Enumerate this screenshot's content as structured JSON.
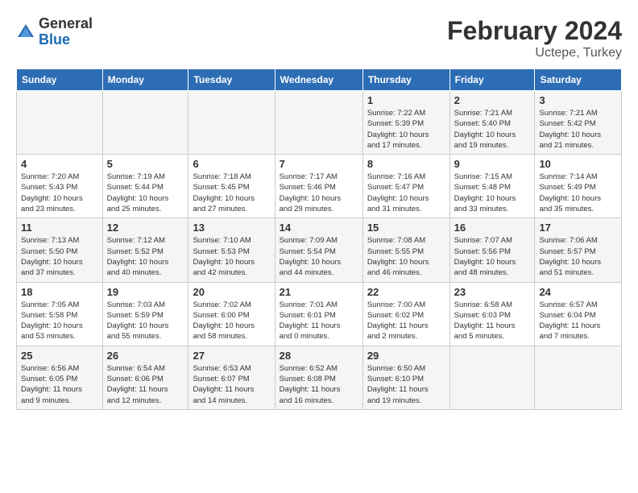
{
  "header": {
    "logo_general": "General",
    "logo_blue": "Blue",
    "month_title": "February 2024",
    "location": "Uctepe, Turkey"
  },
  "calendar": {
    "weekdays": [
      "Sunday",
      "Monday",
      "Tuesday",
      "Wednesday",
      "Thursday",
      "Friday",
      "Saturday"
    ],
    "weeks": [
      [
        {
          "day": "",
          "info": ""
        },
        {
          "day": "",
          "info": ""
        },
        {
          "day": "",
          "info": ""
        },
        {
          "day": "",
          "info": ""
        },
        {
          "day": "1",
          "info": "Sunrise: 7:22 AM\nSunset: 5:39 PM\nDaylight: 10 hours\nand 17 minutes."
        },
        {
          "day": "2",
          "info": "Sunrise: 7:21 AM\nSunset: 5:40 PM\nDaylight: 10 hours\nand 19 minutes."
        },
        {
          "day": "3",
          "info": "Sunrise: 7:21 AM\nSunset: 5:42 PM\nDaylight: 10 hours\nand 21 minutes."
        }
      ],
      [
        {
          "day": "4",
          "info": "Sunrise: 7:20 AM\nSunset: 5:43 PM\nDaylight: 10 hours\nand 23 minutes."
        },
        {
          "day": "5",
          "info": "Sunrise: 7:19 AM\nSunset: 5:44 PM\nDaylight: 10 hours\nand 25 minutes."
        },
        {
          "day": "6",
          "info": "Sunrise: 7:18 AM\nSunset: 5:45 PM\nDaylight: 10 hours\nand 27 minutes."
        },
        {
          "day": "7",
          "info": "Sunrise: 7:17 AM\nSunset: 5:46 PM\nDaylight: 10 hours\nand 29 minutes."
        },
        {
          "day": "8",
          "info": "Sunrise: 7:16 AM\nSunset: 5:47 PM\nDaylight: 10 hours\nand 31 minutes."
        },
        {
          "day": "9",
          "info": "Sunrise: 7:15 AM\nSunset: 5:48 PM\nDaylight: 10 hours\nand 33 minutes."
        },
        {
          "day": "10",
          "info": "Sunrise: 7:14 AM\nSunset: 5:49 PM\nDaylight: 10 hours\nand 35 minutes."
        }
      ],
      [
        {
          "day": "11",
          "info": "Sunrise: 7:13 AM\nSunset: 5:50 PM\nDaylight: 10 hours\nand 37 minutes."
        },
        {
          "day": "12",
          "info": "Sunrise: 7:12 AM\nSunset: 5:52 PM\nDaylight: 10 hours\nand 40 minutes."
        },
        {
          "day": "13",
          "info": "Sunrise: 7:10 AM\nSunset: 5:53 PM\nDaylight: 10 hours\nand 42 minutes."
        },
        {
          "day": "14",
          "info": "Sunrise: 7:09 AM\nSunset: 5:54 PM\nDaylight: 10 hours\nand 44 minutes."
        },
        {
          "day": "15",
          "info": "Sunrise: 7:08 AM\nSunset: 5:55 PM\nDaylight: 10 hours\nand 46 minutes."
        },
        {
          "day": "16",
          "info": "Sunrise: 7:07 AM\nSunset: 5:56 PM\nDaylight: 10 hours\nand 48 minutes."
        },
        {
          "day": "17",
          "info": "Sunrise: 7:06 AM\nSunset: 5:57 PM\nDaylight: 10 hours\nand 51 minutes."
        }
      ],
      [
        {
          "day": "18",
          "info": "Sunrise: 7:05 AM\nSunset: 5:58 PM\nDaylight: 10 hours\nand 53 minutes."
        },
        {
          "day": "19",
          "info": "Sunrise: 7:03 AM\nSunset: 5:59 PM\nDaylight: 10 hours\nand 55 minutes."
        },
        {
          "day": "20",
          "info": "Sunrise: 7:02 AM\nSunset: 6:00 PM\nDaylight: 10 hours\nand 58 minutes."
        },
        {
          "day": "21",
          "info": "Sunrise: 7:01 AM\nSunset: 6:01 PM\nDaylight: 11 hours\nand 0 minutes."
        },
        {
          "day": "22",
          "info": "Sunrise: 7:00 AM\nSunset: 6:02 PM\nDaylight: 11 hours\nand 2 minutes."
        },
        {
          "day": "23",
          "info": "Sunrise: 6:58 AM\nSunset: 6:03 PM\nDaylight: 11 hours\nand 5 minutes."
        },
        {
          "day": "24",
          "info": "Sunrise: 6:57 AM\nSunset: 6:04 PM\nDaylight: 11 hours\nand 7 minutes."
        }
      ],
      [
        {
          "day": "25",
          "info": "Sunrise: 6:56 AM\nSunset: 6:05 PM\nDaylight: 11 hours\nand 9 minutes."
        },
        {
          "day": "26",
          "info": "Sunrise: 6:54 AM\nSunset: 6:06 PM\nDaylight: 11 hours\nand 12 minutes."
        },
        {
          "day": "27",
          "info": "Sunrise: 6:53 AM\nSunset: 6:07 PM\nDaylight: 11 hours\nand 14 minutes."
        },
        {
          "day": "28",
          "info": "Sunrise: 6:52 AM\nSunset: 6:08 PM\nDaylight: 11 hours\nand 16 minutes."
        },
        {
          "day": "29",
          "info": "Sunrise: 6:50 AM\nSunset: 6:10 PM\nDaylight: 11 hours\nand 19 minutes."
        },
        {
          "day": "",
          "info": ""
        },
        {
          "day": "",
          "info": ""
        }
      ]
    ]
  }
}
